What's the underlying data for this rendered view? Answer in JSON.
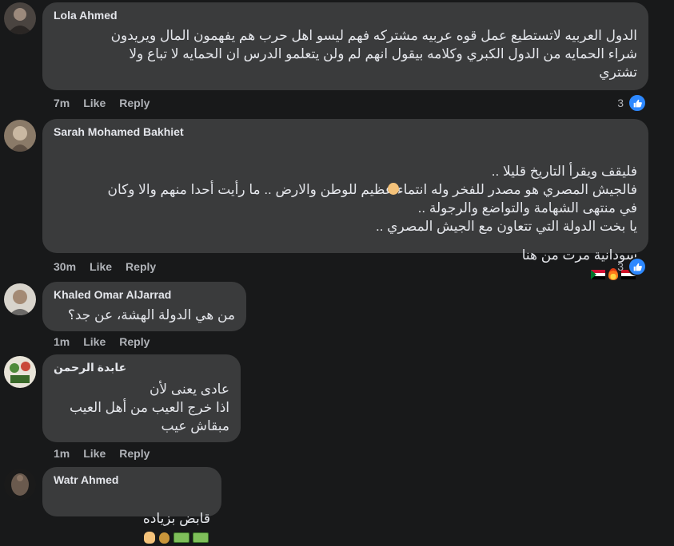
{
  "comments": [
    {
      "author": "Lola Ahmed",
      "text": "الدول العربيه لاتستطيع عمل قوه عربيه مشتركه فهم ليسو اهل حرب هم يفهمون المال ويريدون\nشراء الحمايه من الدول الكبري وكلامه بيقول انهم لم ولن يتعلمو الدرس ان الحمايه لا تباع ولا\nتشتري",
      "time": "7m",
      "like_label": "Like",
      "reply_label": "Reply",
      "reaction_count": "3"
    },
    {
      "author": "Sarah Mohamed Bakhiet",
      "text": "فليقف ويقرأ التاريخ قليلا ..\nفالجيش المصري هو مصدر للفخر وله انتماء عظيم للوطن والارض .. ما رأيت أحدا منهم والا وكان\nفي منتهى الشهامة والتواضع والرجولة ..\nيا بخت الدولة التي تتعاون مع الجيش المصري ..",
      "last_line": "سودانية مرت من هنا",
      "time": "30m",
      "like_label": "Like",
      "reply_label": "Reply",
      "reaction_count": "3"
    },
    {
      "author": "Khaled Omar AlJarrad",
      "text": "من هي الدولة الهشة، عن جد؟",
      "time": "1m",
      "like_label": "Like",
      "reply_label": "Reply"
    },
    {
      "author": "عابدة الرحمن",
      "text": "عادى يعنى لأن\nاذا خرج العيب من أهل العيب\nمبقاش عيب",
      "time": "1m",
      "like_label": "Like",
      "reply_label": "Reply"
    },
    {
      "author": "Watr Ahmed",
      "text": "قابض بزياده",
      "time": "",
      "like_label": "",
      "reply_label": ""
    }
  ],
  "icons": {
    "like_reaction": "like-thumb-icon",
    "flag_egypt": "egypt-flag-icon",
    "flag_sudan": "sudan-flag-icon",
    "fire": "fire-icon",
    "ok_hand": "ok-hand-icon",
    "money": "money-bill-icon",
    "money_bag": "money-bag-icon",
    "hand": "hand-icon"
  },
  "colors": {
    "background": "#18191a",
    "bubble": "#3a3b3c",
    "text": "#e4e6eb",
    "secondary_text": "#b0b3b8",
    "like_blue": "#2d88ff"
  }
}
